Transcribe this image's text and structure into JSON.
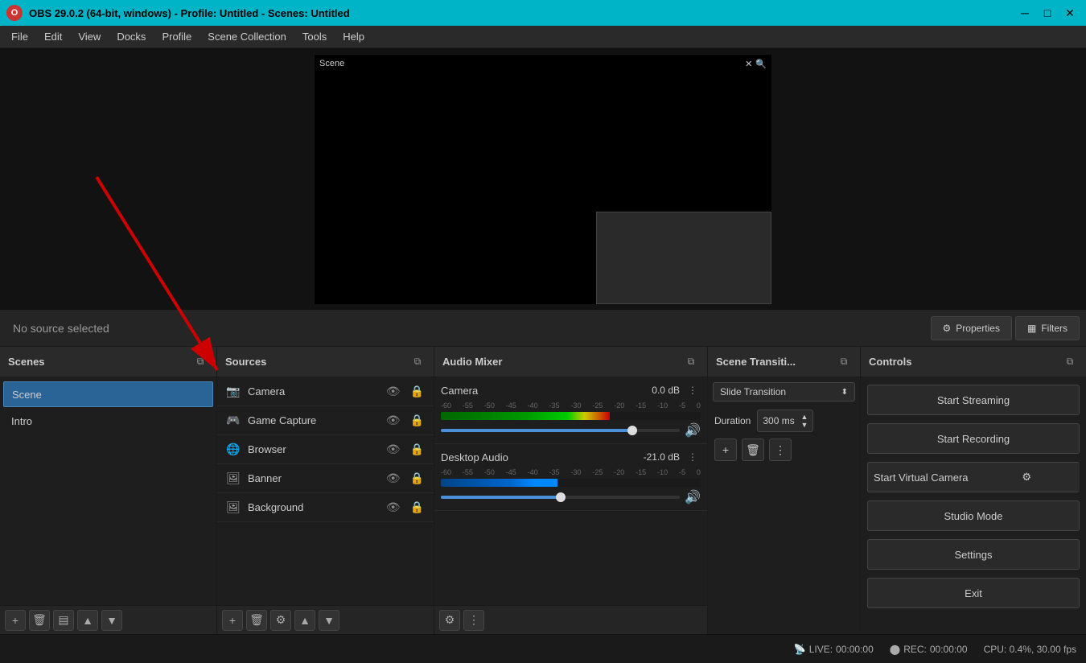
{
  "titlebar": {
    "title": "OBS 29.0.2 (64-bit, windows) - Profile: Untitled - Scenes: Untitled",
    "min_btn": "─",
    "max_btn": "□",
    "close_btn": "✕"
  },
  "menubar": {
    "items": [
      "File",
      "Edit",
      "View",
      "Docks",
      "Profile",
      "Scene Collection",
      "Tools",
      "Help"
    ]
  },
  "preview": {
    "scene_label": "Scene"
  },
  "properties_bar": {
    "no_source": "No source selected",
    "properties_btn": "Properties",
    "filters_btn": "Filters"
  },
  "scenes_panel": {
    "title": "Scenes",
    "items": [
      {
        "name": "Scene",
        "active": true
      },
      {
        "name": "Intro",
        "active": false
      }
    ]
  },
  "sources_panel": {
    "title": "Sources",
    "items": [
      {
        "name": "Camera",
        "icon": "📷"
      },
      {
        "name": "Game Capture",
        "icon": "🎮"
      },
      {
        "name": "Browser",
        "icon": "🌐"
      },
      {
        "name": "Banner",
        "icon": "🖼"
      },
      {
        "name": "Background",
        "icon": "🖼"
      }
    ]
  },
  "audio_panel": {
    "title": "Audio Mixer",
    "channels": [
      {
        "name": "Camera",
        "db": "0.0 dB",
        "meter_pct": 65,
        "vol_pct": 80
      },
      {
        "name": "Desktop Audio",
        "db": "-21.0 dB",
        "meter_pct": 45,
        "vol_pct": 50
      }
    ],
    "scale_labels": [
      "-60",
      "-55",
      "-50",
      "-45",
      "-40",
      "-35",
      "-30",
      "-25",
      "-20",
      "-15",
      "-10",
      "-5",
      "0"
    ]
  },
  "transitions_panel": {
    "title": "Scene Transiti...",
    "transition_name": "Slide Transition",
    "duration_label": "Duration",
    "duration_value": "300 ms"
  },
  "controls_panel": {
    "title": "Controls",
    "start_streaming": "Start Streaming",
    "start_recording": "Start Recording",
    "start_virtual_camera": "Start Virtual Camera",
    "studio_mode": "Studio Mode",
    "settings": "Settings",
    "exit": "Exit"
  },
  "statusbar": {
    "live_label": "LIVE:",
    "live_time": "00:00:00",
    "rec_label": "REC:",
    "rec_time": "00:00:00",
    "cpu": "CPU: 0.4%, 30.00 fps"
  }
}
